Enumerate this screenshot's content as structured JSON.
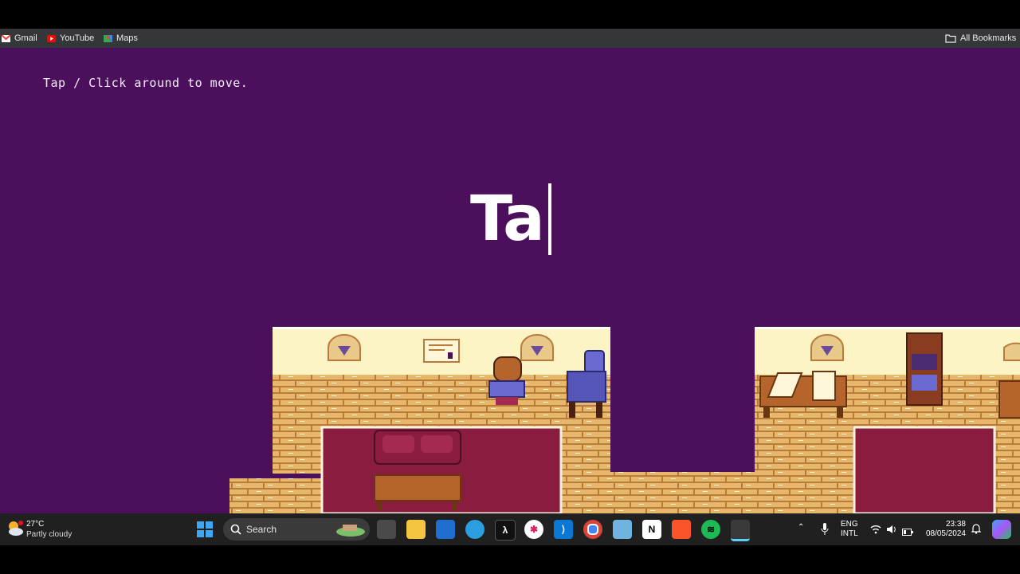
{
  "bookmarks": {
    "items": [
      {
        "label": "Gmail",
        "icon": "gmail-icon"
      },
      {
        "label": "YouTube",
        "icon": "youtube-icon"
      },
      {
        "label": "Maps",
        "icon": "maps-icon"
      }
    ],
    "all_bookmarks": "All Bookmarks"
  },
  "game": {
    "hint": "Tap / Click around to move.",
    "typed_text": "Ta",
    "background_color": "#4c0f5c"
  },
  "taskbar": {
    "weather": {
      "temp": "27°C",
      "desc": "Partly cloudy"
    },
    "search_label": "Search",
    "apps": [
      "task-view",
      "file-explorer",
      "microsoft-store",
      "edge-browser",
      "code-app",
      "slack",
      "vscode",
      "chrome",
      "photos",
      "notion",
      "brave",
      "spotify",
      "snipping-tool"
    ],
    "lang": "ENG",
    "layout": "INTL",
    "time": "23:38",
    "date": "08/05/2024"
  }
}
